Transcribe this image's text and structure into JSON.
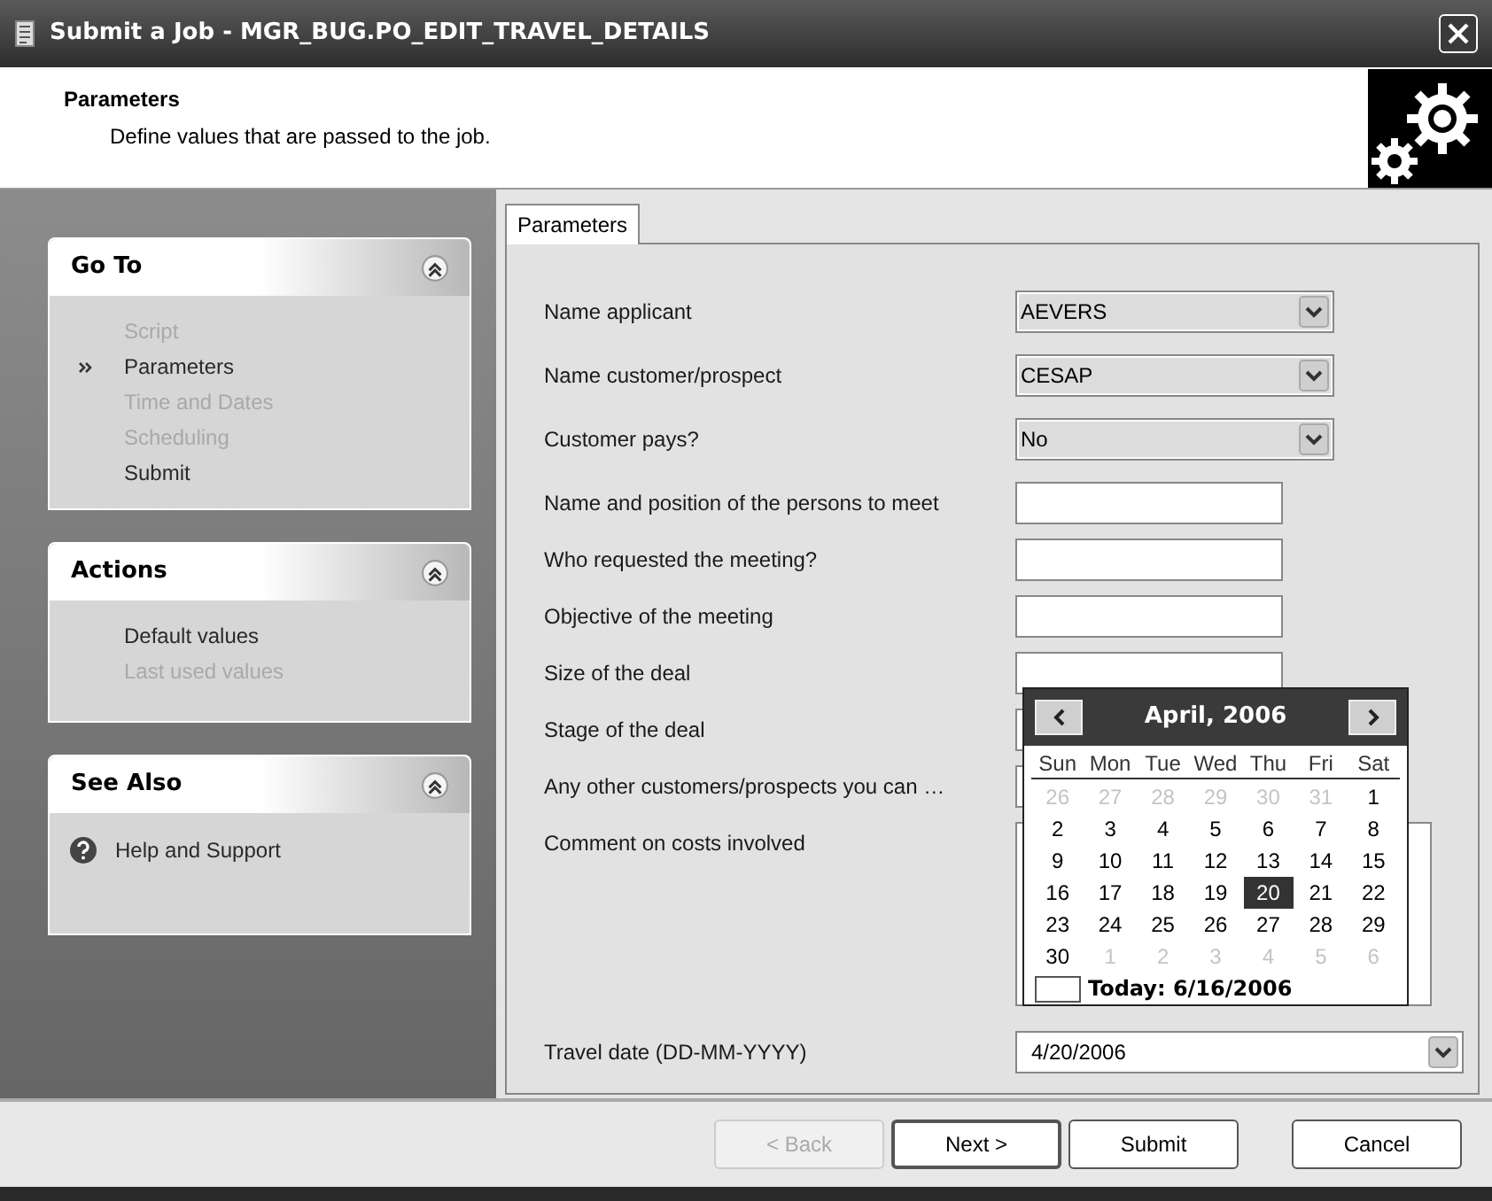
{
  "window": {
    "title": "Submit a Job - MGR_BUG.PO_EDIT_TRAVEL_DETAILS"
  },
  "header": {
    "title": "Parameters",
    "subtitle": "Define values that are passed to the job."
  },
  "sidebar": {
    "panels": [
      {
        "title": "Go To",
        "expanded": true,
        "items": [
          {
            "label": "Script",
            "current": false,
            "disabled": true
          },
          {
            "label": "Parameters",
            "current": true,
            "disabled": false
          },
          {
            "label": "Time and Dates",
            "current": false,
            "disabled": true
          },
          {
            "label": "Scheduling",
            "current": false,
            "disabled": true
          },
          {
            "label": "Submit",
            "current": false,
            "disabled": false
          }
        ]
      },
      {
        "title": "Actions",
        "expanded": true,
        "items": [
          {
            "label": "Default values",
            "current": false,
            "disabled": false
          },
          {
            "label": "Last used values",
            "current": false,
            "disabled": true
          }
        ]
      },
      {
        "title": "See Also",
        "expanded": true,
        "items": [
          {
            "label": "Help and Support",
            "disabled": false,
            "kind": "help"
          }
        ]
      }
    ]
  },
  "tabs": [
    {
      "label": "Parameters",
      "selected": true
    }
  ],
  "fields": [
    {
      "kind": "combo",
      "label": "Name applicant",
      "value": "AEVERS"
    },
    {
      "kind": "combo",
      "label": "Name customer/prospect",
      "value": "CESAP"
    },
    {
      "kind": "combo",
      "label": "Customer pays?",
      "value": "No"
    },
    {
      "kind": "text",
      "label": "Name and position of the persons to meet"
    },
    {
      "kind": "text",
      "label": "Who requested the meeting?"
    },
    {
      "kind": "text",
      "label": "Objective of the meeting"
    },
    {
      "kind": "text",
      "label": "Size of the deal"
    },
    {
      "kind": "text",
      "label": "Stage of the deal"
    },
    {
      "kind": "text",
      "label": "Any other customers/prospects you can …"
    },
    {
      "kind": "textarea",
      "label": "Comment on costs involved"
    },
    {
      "kind": "date",
      "label": "Travel date (DD-MM-YYYY)",
      "value": "4/20/2006"
    }
  ],
  "calendar": {
    "month": "April, 2006",
    "day_names": [
      "Sun",
      "Mon",
      "Tue",
      "Wed",
      "Thu",
      "Fri",
      "Sat"
    ],
    "weeks": [
      [
        {
          "day": "26",
          "muted": true,
          "selected": false
        },
        {
          "day": "27",
          "muted": true,
          "selected": false
        },
        {
          "day": "28",
          "muted": true,
          "selected": false
        },
        {
          "day": "29",
          "muted": true,
          "selected": false
        },
        {
          "day": "30",
          "muted": true,
          "selected": false
        },
        {
          "day": "31",
          "muted": true,
          "selected": false
        },
        {
          "day": "1",
          "muted": false,
          "selected": false
        }
      ],
      [
        {
          "day": "2",
          "muted": false,
          "selected": false
        },
        {
          "day": "3",
          "muted": false,
          "selected": false
        },
        {
          "day": "4",
          "muted": false,
          "selected": false
        },
        {
          "day": "5",
          "muted": false,
          "selected": false
        },
        {
          "day": "6",
          "muted": false,
          "selected": false
        },
        {
          "day": "7",
          "muted": false,
          "selected": false
        },
        {
          "day": "8",
          "muted": false,
          "selected": false
        }
      ],
      [
        {
          "day": "9",
          "muted": false,
          "selected": false
        },
        {
          "day": "10",
          "muted": false,
          "selected": false
        },
        {
          "day": "11",
          "muted": false,
          "selected": false
        },
        {
          "day": "12",
          "muted": false,
          "selected": false
        },
        {
          "day": "13",
          "muted": false,
          "selected": false
        },
        {
          "day": "14",
          "muted": false,
          "selected": false
        },
        {
          "day": "15",
          "muted": false,
          "selected": false
        }
      ],
      [
        {
          "day": "16",
          "muted": false,
          "selected": false
        },
        {
          "day": "17",
          "muted": false,
          "selected": false
        },
        {
          "day": "18",
          "muted": false,
          "selected": false
        },
        {
          "day": "19",
          "muted": false,
          "selected": false
        },
        {
          "day": "20",
          "muted": false,
          "selected": true
        },
        {
          "day": "21",
          "muted": false,
          "selected": false
        },
        {
          "day": "22",
          "muted": false,
          "selected": false
        }
      ],
      [
        {
          "day": "23",
          "muted": false,
          "selected": false
        },
        {
          "day": "24",
          "muted": false,
          "selected": false
        },
        {
          "day": "25",
          "muted": false,
          "selected": false
        },
        {
          "day": "26",
          "muted": false,
          "selected": false
        },
        {
          "day": "27",
          "muted": false,
          "selected": false
        },
        {
          "day": "28",
          "muted": false,
          "selected": false
        },
        {
          "day": "29",
          "muted": false,
          "selected": false
        }
      ],
      [
        {
          "day": "30",
          "muted": false,
          "selected": false
        },
        {
          "day": "1",
          "muted": true,
          "selected": false
        },
        {
          "day": "2",
          "muted": true,
          "selected": false
        },
        {
          "day": "3",
          "muted": true,
          "selected": false
        },
        {
          "day": "4",
          "muted": true,
          "selected": false
        },
        {
          "day": "5",
          "muted": true,
          "selected": false
        },
        {
          "day": "6",
          "muted": true,
          "selected": false
        }
      ]
    ],
    "today": "Today: 6/16/2006"
  },
  "buttons": [
    {
      "label": "< Back",
      "disabled": true,
      "default": false
    },
    {
      "label": "Next >",
      "disabled": false,
      "default": true
    },
    {
      "label": "Submit",
      "disabled": false,
      "default": false
    },
    {
      "label": "Cancel",
      "disabled": false,
      "default": false
    }
  ]
}
